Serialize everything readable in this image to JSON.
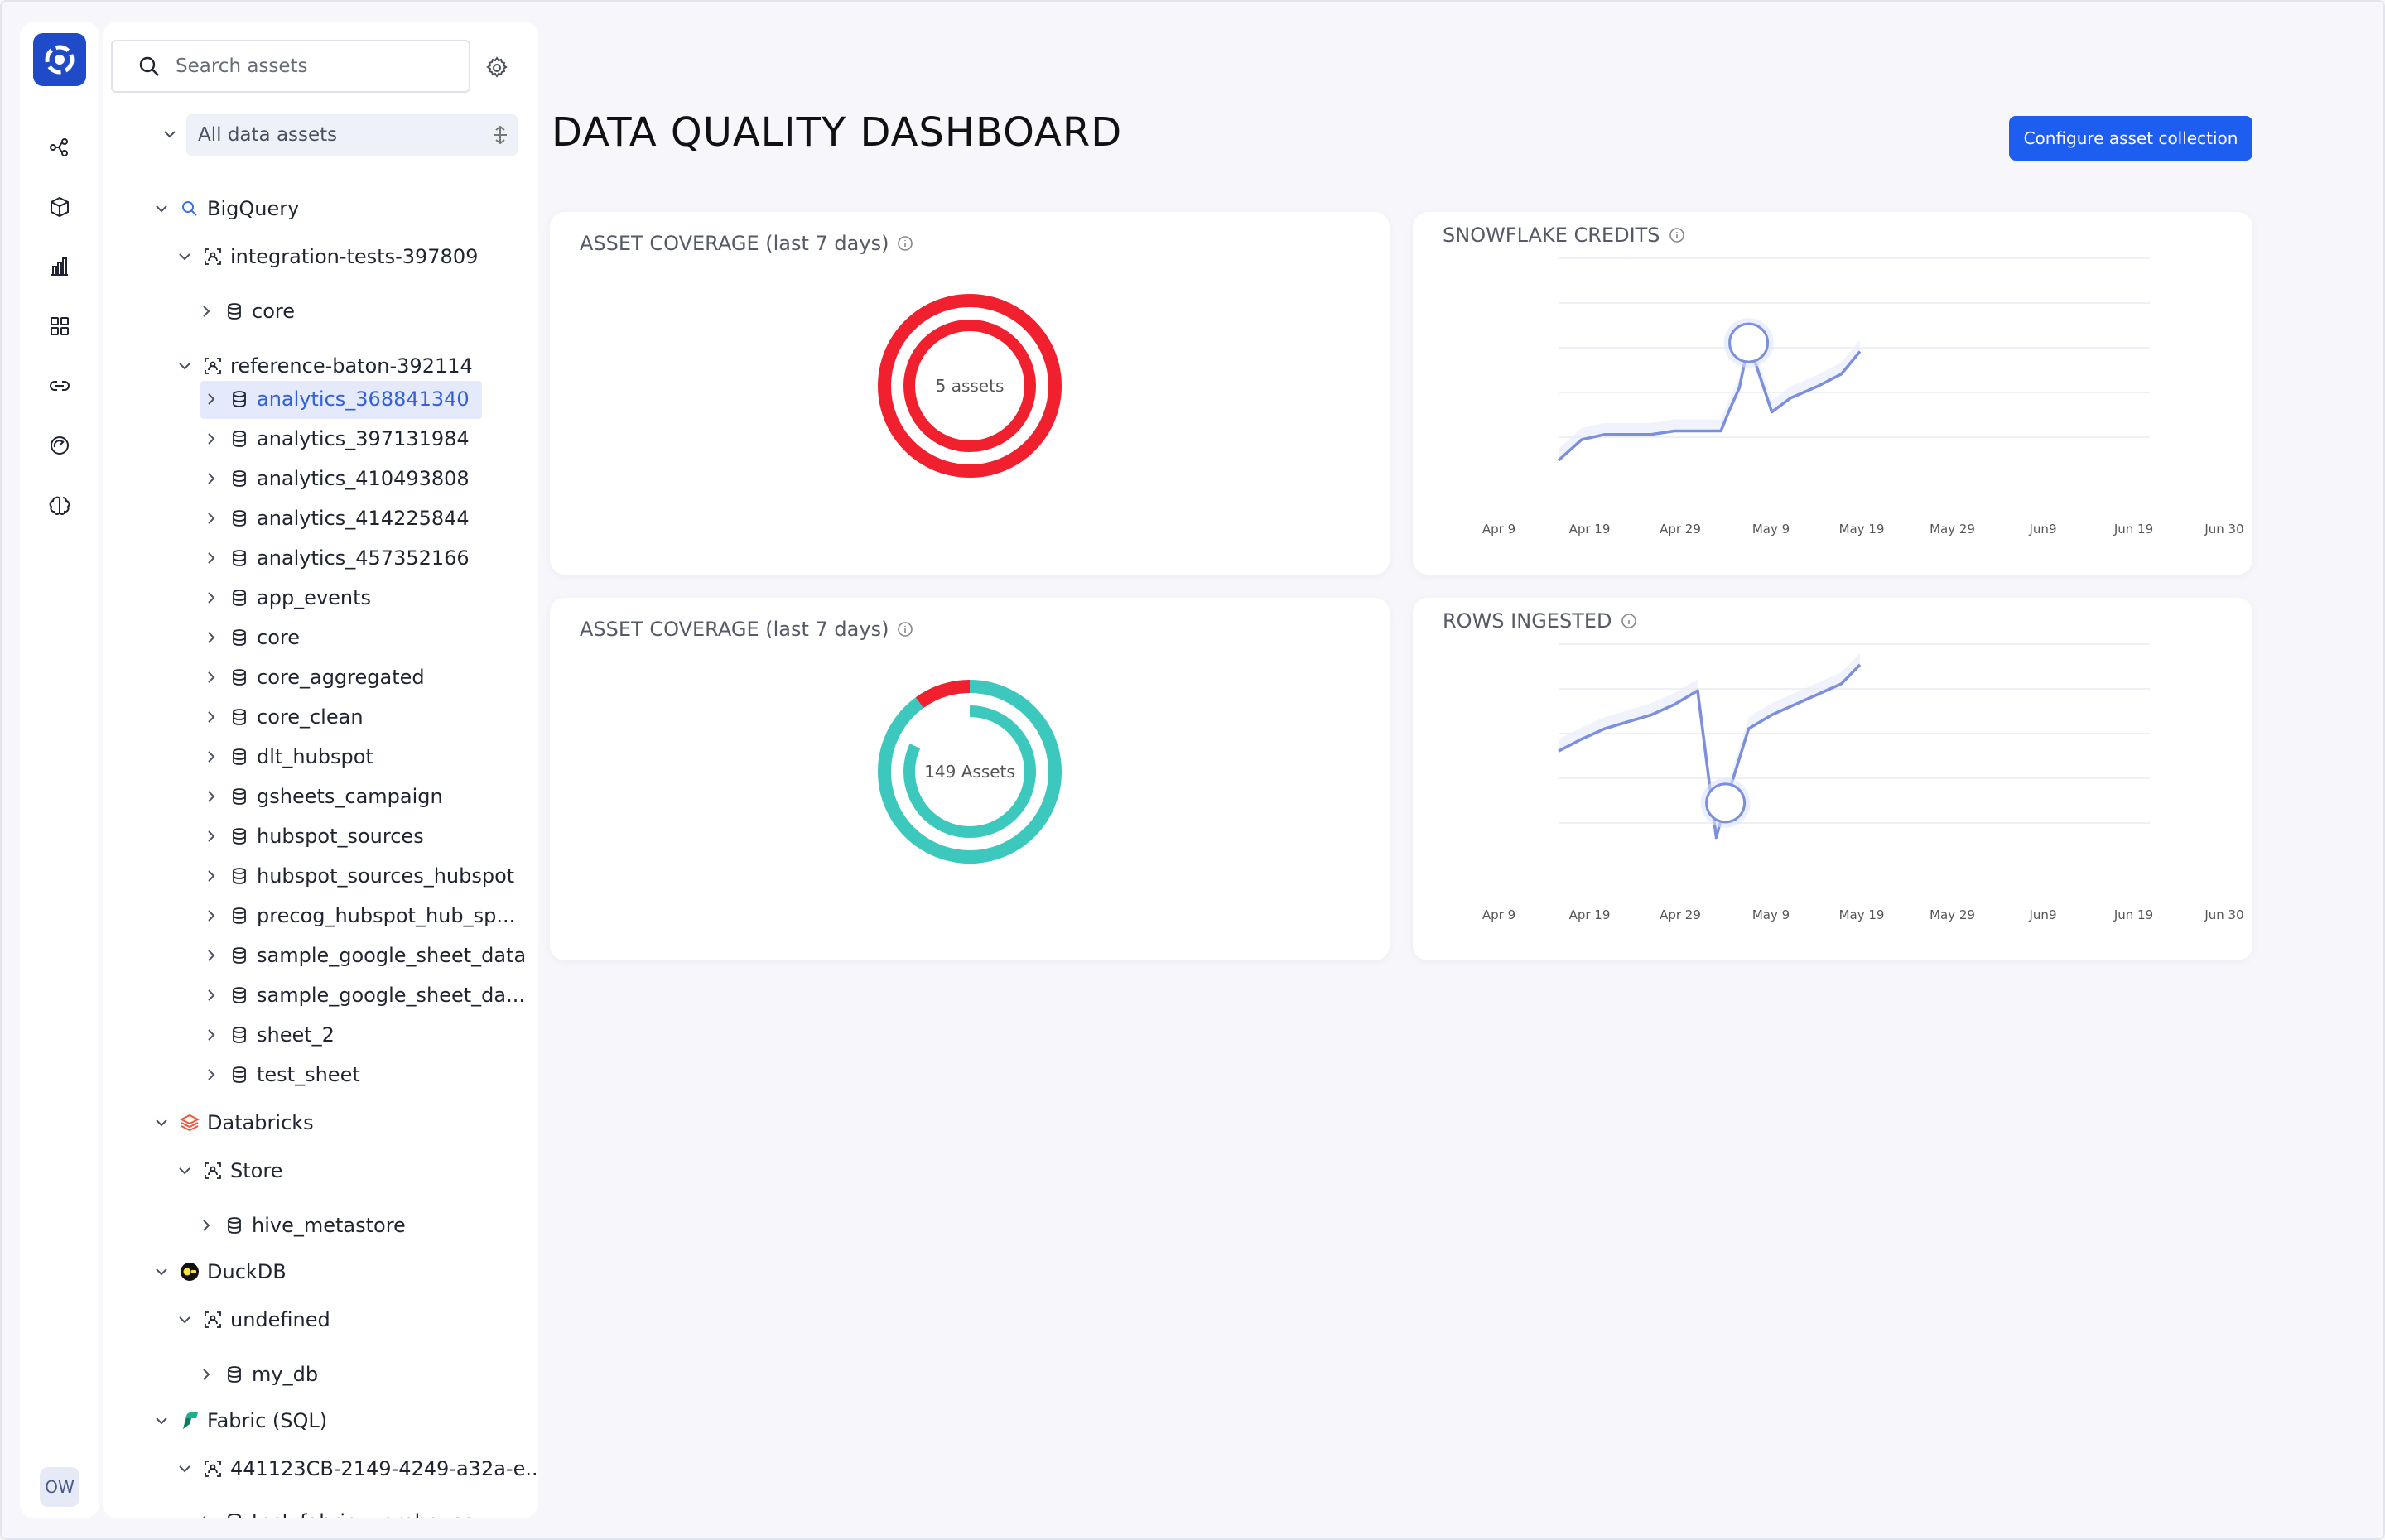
{
  "app": {
    "avatar_initials": "OW",
    "brand_color": "#1f4bc8",
    "accent_color": "#1d5ef0"
  },
  "rail": {
    "items": [
      {
        "icon": "lineage-icon"
      },
      {
        "icon": "cube-icon"
      },
      {
        "icon": "bar-chart-icon"
      },
      {
        "icon": "grid-icon"
      },
      {
        "icon": "link-icon"
      },
      {
        "icon": "gauge-icon"
      },
      {
        "icon": "brain-icon"
      }
    ]
  },
  "sidebar": {
    "search_placeholder": "Search assets",
    "all_assets_label": "All data assets",
    "tree": {
      "bigquery": "BigQuery",
      "integration_tests": "integration-tests-397809",
      "core_1": "core",
      "reference_baton": "reference-baton-392114",
      "datasets": [
        "analytics_368841340",
        "analytics_397131984",
        "analytics_410493808",
        "analytics_414225844",
        "analytics_457352166",
        "app_events",
        "core",
        "core_aggregated",
        "core_clean",
        "dlt_hubspot",
        "gsheets_campaign",
        "hubspot_sources",
        "hubspot_sources_hubspot",
        "precog_hubspot_hub_sp...",
        "sample_google_sheet_data",
        "sample_google_sheet_da...",
        "sheet_2",
        "test_sheet"
      ],
      "databricks": "Databricks",
      "store": "Store",
      "hive_metastore": "hive_metastore",
      "duckdb": "DuckDB",
      "undefined": "undefined",
      "my_db": "my_db",
      "fabric": "Fabric (SQL)",
      "fabric_project": "441123CB-2149-4249-a32a-e...",
      "fabric_warehouse": "test_fabric_warehouse"
    }
  },
  "main": {
    "title": "DATA QUALITY DASHBOARD",
    "configure_label": "Configure asset collection",
    "cards": {
      "coverage_1": {
        "title": "ASSET COVERAGE (last 7 days)",
        "center_label": "5 assets"
      },
      "credits": {
        "title": "SNOWFLAKE CREDITS"
      },
      "coverage_2": {
        "title": "ASSET COVERAGE (last 7 days)",
        "center_label": "149 Assets"
      },
      "rows": {
        "title": "ROWS INGESTED"
      }
    }
  },
  "chart_data": [
    {
      "type": "pie",
      "title": "ASSET COVERAGE (last 7 days)",
      "center_label": "5 assets",
      "rings": [
        {
          "values": [
            1.0
          ],
          "colors": [
            "#f0202f"
          ]
        },
        {
          "values": [
            1.0
          ],
          "colors": [
            "#f0202f"
          ]
        }
      ]
    },
    {
      "type": "line",
      "title": "SNOWFLAKE CREDITS",
      "categories": [
        "Apr 9",
        "Apr 19",
        "Apr 29",
        "May 9",
        "May 19",
        "May 29",
        "Jun9",
        "Jun 19",
        "Jun 30"
      ],
      "x": [
        0,
        0.5,
        1,
        1.5,
        2,
        2.5,
        3,
        3.5,
        3.7,
        3.9,
        4.1,
        4.6,
        5,
        5.6,
        6.1,
        6.5
      ],
      "values": [
        0.0,
        0.12,
        0.15,
        0.15,
        0.15,
        0.17,
        0.17,
        0.17,
        0.3,
        0.42,
        0.68,
        0.28,
        0.36,
        0.43,
        0.5,
        0.63
      ],
      "highlight_index": 10,
      "color": "#7b8fdc"
    },
    {
      "type": "pie",
      "title": "ASSET COVERAGE (last 7 days)",
      "center_label": "149 Assets",
      "rings": [
        {
          "values": [
            0.9,
            0.1
          ],
          "colors": [
            "#3cc8bd",
            "#f0202f"
          ]
        },
        {
          "values": [
            0.82,
            0.18
          ],
          "colors": [
            "#3cc8bd",
            "#ffffff"
          ]
        }
      ]
    },
    {
      "type": "line",
      "title": "ROWS INGESTED",
      "categories": [
        "Apr 9",
        "Apr 19",
        "Apr 29",
        "May 9",
        "May 19",
        "May 29",
        "Jun9",
        "Jun 19",
        "Jun 30"
      ],
      "x": [
        0,
        0.5,
        1,
        1.5,
        2,
        2.5,
        3,
        3.4,
        3.6,
        4.1,
        4.6,
        5.1,
        5.6,
        6.1,
        6.5
      ],
      "values": [
        0.55,
        0.62,
        0.68,
        0.72,
        0.76,
        0.82,
        0.9,
        0.05,
        0.25,
        0.68,
        0.76,
        0.82,
        0.88,
        0.94,
        1.05
      ],
      "highlight_index": 8,
      "color": "#7b8fdc"
    }
  ]
}
